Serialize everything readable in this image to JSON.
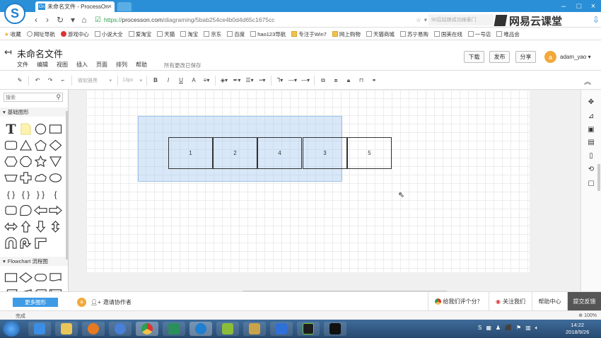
{
  "browser": {
    "logo_glyph": "S",
    "tab_title": "未命名文件 - ProcessOn",
    "tab_favicon": "On",
    "url_scheme": "https://",
    "url_host": "processon.com",
    "url_path": "/diagraming/5bab254ce4b0d4d65c1675cc",
    "search_hint": "90后姑娘成功嫁豪门",
    "ad_brand": "网易云课堂"
  },
  "bookmarks": [
    {
      "label": "收藏",
      "kind": "star"
    },
    {
      "label": "网址导航",
      "kind": "page"
    },
    {
      "label": "游戏中心",
      "kind": "red"
    },
    {
      "label": "小说大全",
      "kind": "page"
    },
    {
      "label": "爱淘宝",
      "kind": "page"
    },
    {
      "label": "天猫",
      "kind": "page"
    },
    {
      "label": "淘宝",
      "kind": "page"
    },
    {
      "label": "京东",
      "kind": "page"
    },
    {
      "label": "百度",
      "kind": "page"
    },
    {
      "label": "hao123导航",
      "kind": "page"
    },
    {
      "label": "专注于Win7",
      "kind": "folder"
    },
    {
      "label": "网上购物",
      "kind": "folder"
    },
    {
      "label": "天猫商城",
      "kind": "page"
    },
    {
      "label": "苏宁易购",
      "kind": "page"
    },
    {
      "label": "国美在线",
      "kind": "page"
    },
    {
      "label": "一号店",
      "kind": "page"
    },
    {
      "label": "唯品会",
      "kind": "page"
    }
  ],
  "app": {
    "doc_title": "未命名文件",
    "menu": [
      "文件",
      "编辑",
      "视图",
      "插入",
      "页面",
      "排列",
      "帮助"
    ],
    "saved_status": "所有更改已保存",
    "download_label": "下载",
    "publish_label": "发布",
    "share_label": "分享",
    "user_initial": "a",
    "username": "adam_yao"
  },
  "toolbar": {
    "font_family": "微软雅黑",
    "font_size": "13px"
  },
  "left_panel": {
    "search_placeholder": "搜索",
    "category_basic": "基础图形",
    "category_flowchart": "Flowchart 流程图"
  },
  "canvas": {
    "nodes": [
      {
        "label": "1"
      },
      {
        "label": "2"
      },
      {
        "label": "4"
      },
      {
        "label": "3"
      },
      {
        "label": "5"
      }
    ]
  },
  "bottom": {
    "more_shapes": "更多图形",
    "invite_initial": "a",
    "invite_label": "邀请协作者",
    "rate_label": "给我们评个分？",
    "follow_label": "关注我们",
    "help_label": "帮助中心",
    "feedback_label": "提交反馈"
  },
  "statusbar": {
    "status": "完成",
    "zoom": "100%"
  },
  "taskbar": {
    "time": "14:22",
    "date": "2018/9/26"
  },
  "colors": {
    "browser_blue": "#2a8fd6",
    "selection_fill": "#aacdf0",
    "accent_orange": "#f2a93b",
    "button_blue": "#3e9be5"
  }
}
